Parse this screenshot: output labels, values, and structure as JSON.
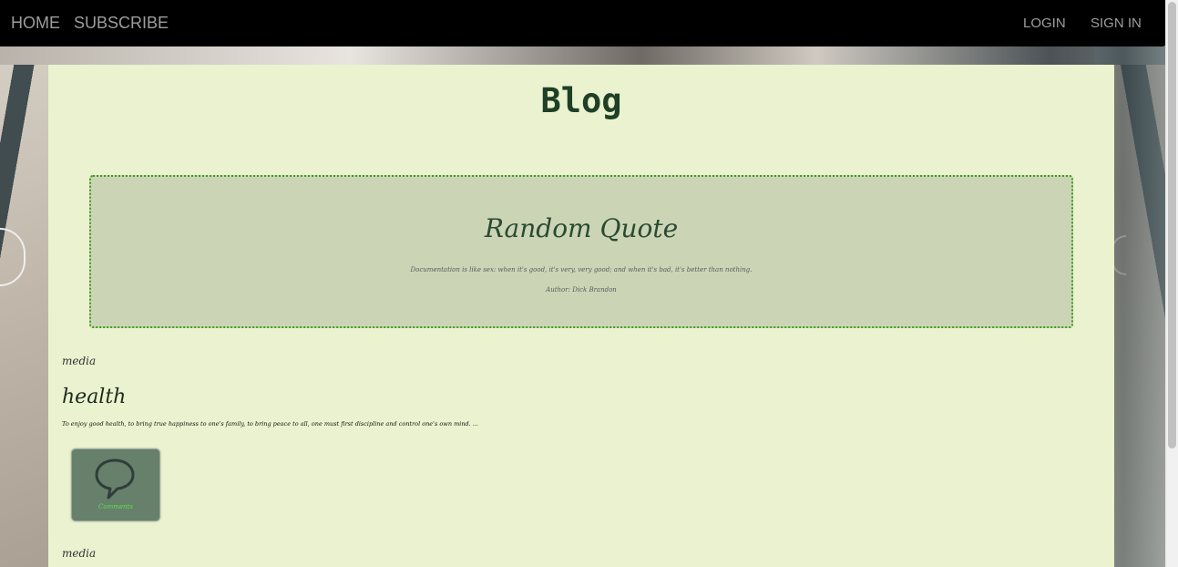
{
  "navbar": {
    "left": [
      {
        "label": "HOME"
      },
      {
        "label": "SUBSCRIBE"
      }
    ],
    "right": [
      {
        "label": "LOGIN"
      },
      {
        "label": "SIGN IN"
      }
    ]
  },
  "page": {
    "title": "Blog"
  },
  "quote": {
    "heading": "Random Quote",
    "text": "Documentation is like sex: when it's good, it's very, very good; and when it's bad, it's better than nothing.",
    "author": "Author: Dick Brandon"
  },
  "posts": [
    {
      "category": "media",
      "title": "health",
      "excerpt": "To enjoy good health, to bring true happiness to one's family, to bring peace to all, one must first discipline and control one's own mind. ...",
      "comments_label": "Comments",
      "comments_icon": "speech-bubble-icon"
    },
    {
      "category": "media"
    }
  ],
  "colors": {
    "navbar_bg": "#000000",
    "nav_text": "#9d9d9d",
    "panel_bg": "#eaf2cf",
    "quote_bg": "#cbd5b6",
    "quote_border": "#3f9a1a",
    "comments_bg": "#66806b",
    "comments_label": "#5fe04a"
  }
}
